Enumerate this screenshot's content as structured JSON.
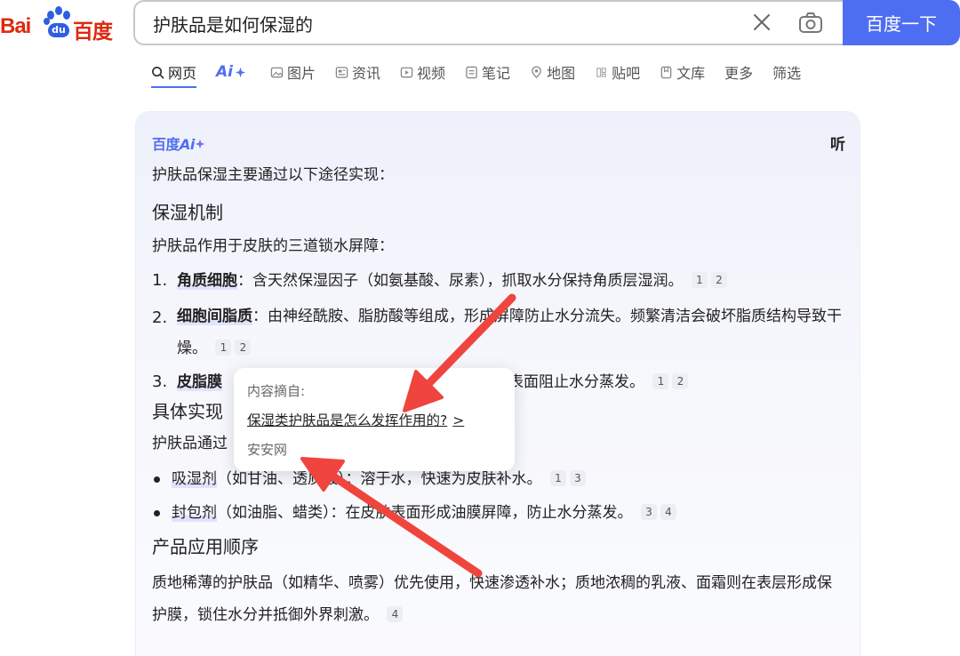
{
  "logo": {
    "latin_1": "Bai",
    "paw_text": "du",
    "chinese": "百度"
  },
  "search": {
    "query": "护肤品是如何保湿的",
    "button_label": "百度一下"
  },
  "tabs": [
    {
      "label": "网页",
      "icon": "search-icon"
    },
    {
      "label": "Ai",
      "icon": "sparkle-icon"
    },
    {
      "label": "图片",
      "icon": "image-icon"
    },
    {
      "label": "资讯",
      "icon": "news-icon"
    },
    {
      "label": "视频",
      "icon": "video-icon"
    },
    {
      "label": "笔记",
      "icon": "note-icon"
    },
    {
      "label": "地图",
      "icon": "map-icon"
    },
    {
      "label": "贴吧",
      "icon": "tieba-icon"
    },
    {
      "label": "文库",
      "icon": "document-icon"
    },
    {
      "label": "更多"
    },
    {
      "label": "筛选"
    }
  ],
  "ai_card": {
    "brand_cn": "百度",
    "brand_ai": "Ai",
    "listen_label": "听",
    "intro": "护肤品保湿主要通过以下途径实现：",
    "heading_1": "保湿机制",
    "para_1": "护肤品作用于皮肤的三道锁水屏障：",
    "barriers": [
      {
        "num": "1.",
        "term": "角质细胞",
        "text": "：含天然保湿因子（如氨基酸、尿素），抓取水分保持角质层湿润。",
        "cites": [
          "1",
          "2"
        ]
      },
      {
        "num": "2.",
        "term": "细胞间脂质",
        "text": "：由神经酰胺、脂肪酸等组成，形成屏障防止水分流失。频繁清洁会破坏脂质结构导致干燥。",
        "cites": [
          "1",
          "2"
        ]
      },
      {
        "num": "3.",
        "term": "皮脂膜",
        "text_tail": "肤表面阻止水分蒸发。",
        "cites": [
          "1",
          "2"
        ]
      }
    ],
    "heading_2_visible": "具体实现",
    "para_2_visible": "护肤品通过",
    "ingredients": [
      {
        "term": "吸湿剂",
        "text_head": "（如甘油、透",
        "text_tail": "质酸）：溶于水，快速为皮肤补水。",
        "cites": [
          "1",
          "3"
        ]
      },
      {
        "term": "封包剂",
        "text_head": "（如油脂、蜡类）：在",
        "text_tail": "皮肤表面形成油膜屏障，防止水分蒸发。",
        "cites": [
          "3",
          "4"
        ]
      }
    ],
    "heading_3": "产品应用顺序",
    "para_3": "质地稀薄的护肤品（如精华、喷雾）优先使用，快速渗透补水；质地浓稠的乳液、面霜则在表层形成保护膜，锁住水分并抵御外界刺激。",
    "para_3_cites": [
      "4"
    ]
  },
  "popup": {
    "label": "内容摘自:",
    "link_text": "保湿类护肤品是怎么发挥作用的?",
    "chevron": ">",
    "site": "安安网"
  },
  "colors": {
    "accent": "#4e6ef2",
    "arrow": "#f0443e",
    "logo_red": "#de2910"
  }
}
